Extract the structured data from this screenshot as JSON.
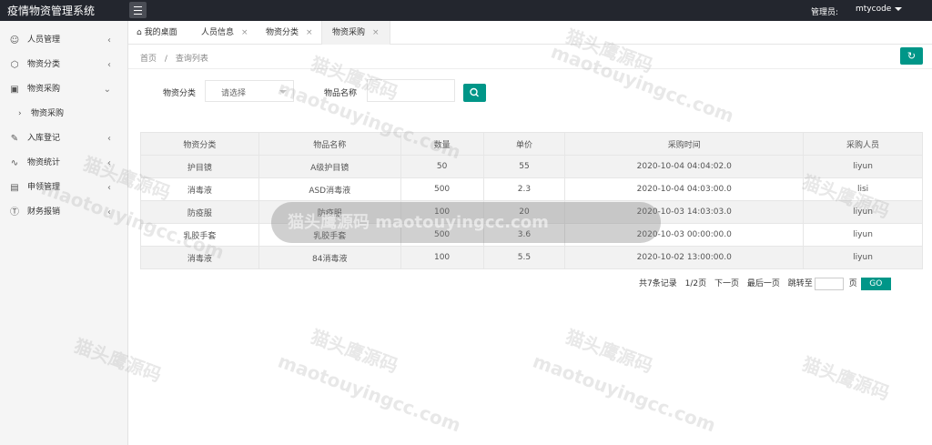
{
  "app": {
    "title": "疫情物资管理系统",
    "admin_label": "管理员:",
    "username": "mtycode"
  },
  "sidebar": {
    "items": [
      {
        "label": "人员管理",
        "icon": "user-icon"
      },
      {
        "label": "物资分类",
        "icon": "cube-icon"
      },
      {
        "label": "物资采购",
        "icon": "truck-icon"
      },
      {
        "label": "物资采购",
        "icon": "chevron-right-icon"
      },
      {
        "label": "入库登记",
        "icon": "edit-icon"
      },
      {
        "label": "物资统计",
        "icon": "pulse-icon"
      },
      {
        "label": "申领管理",
        "icon": "document-icon"
      },
      {
        "label": "财务报销",
        "icon": "dollar-icon"
      }
    ]
  },
  "tabs": [
    {
      "label": "我的桌面",
      "icon": "home-icon"
    },
    {
      "label": "人员信息"
    },
    {
      "label": "物资分类"
    },
    {
      "label": "物资采购"
    }
  ],
  "breadcrumb": {
    "home": "首页",
    "sep": "/",
    "current": "查询列表"
  },
  "filters": {
    "category_label": "物资分类",
    "category_value": "请选择",
    "name_label": "物品名称",
    "name_value": ""
  },
  "table": {
    "headers": [
      "物资分类",
      "物品名称",
      "数量",
      "单价",
      "采购时间",
      "采购人员"
    ],
    "rows": [
      [
        "护目镜",
        "A级护目镜",
        "50",
        "55",
        "2020-10-04 04:04:02.0",
        "liyun"
      ],
      [
        "消毒液",
        "ASD消毒液",
        "500",
        "2.3",
        "2020-10-04 04:03:00.0",
        "lisi"
      ],
      [
        "防疫服",
        "防疫服",
        "100",
        "20",
        "2020-10-03 14:03:03.0",
        "liyun"
      ],
      [
        "乳胶手套",
        "乳胶手套",
        "500",
        "3.6",
        "2020-10-03 00:00:00.0",
        "liyun"
      ],
      [
        "消毒液",
        "84消毒液",
        "100",
        "5.5",
        "2020-10-02 13:00:00.0",
        "liyun"
      ]
    ]
  },
  "pager": {
    "total": "共7条记录",
    "page": "1/2页",
    "next": "下一页",
    "last": "最后一页",
    "jump": "跳转至",
    "page_unit": "页",
    "go": "GO"
  },
  "watermark": {
    "cn": "猫头鹰源码",
    "en": "maotouyingcc.com",
    "overlay": "猫头鹰源码 maotouyingcc.com"
  },
  "colors": {
    "accent": "#009688",
    "topbar": "#23262e"
  }
}
